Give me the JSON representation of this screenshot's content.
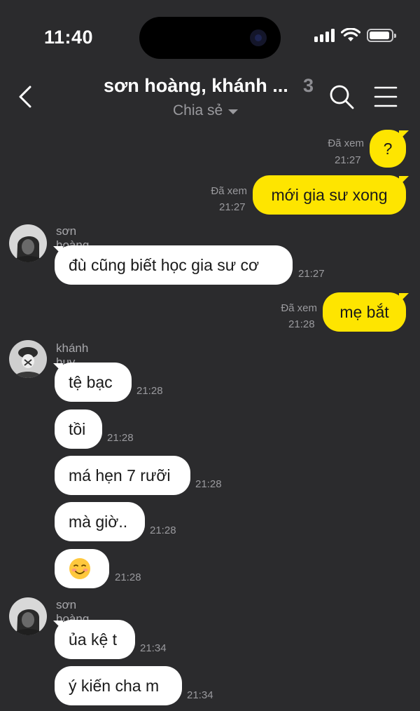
{
  "status_bar": {
    "time": "11:40"
  },
  "header": {
    "title": "sơn hoàng, khánh ...",
    "member_count": "3",
    "subtitle": "Chia sẻ"
  },
  "messages": [
    {
      "from": "me",
      "text": "?",
      "seen": "Đã xem",
      "time": "21:27"
    },
    {
      "from": "me",
      "text": "mới gia sư xong",
      "seen": "Đã xem",
      "time": "21:27"
    },
    {
      "from": "them",
      "sender": "sơn hoàng",
      "text": "đù cũng biết học gia sư cơ",
      "time": "21:27"
    },
    {
      "from": "me",
      "text": "mẹ bắt",
      "seen": "Đã xem",
      "time": "21:28"
    },
    {
      "from": "them",
      "sender": "khánh huy",
      "text": "tệ bạc",
      "time": "21:28"
    },
    {
      "from": "them",
      "text": "tồi",
      "time": "21:28"
    },
    {
      "from": "them",
      "text": "má hẹn 7 rưỡi",
      "time": "21:28"
    },
    {
      "from": "them",
      "text": "mà giờ..",
      "time": "21:28"
    },
    {
      "from": "them",
      "text": "☺️",
      "time": "21:28"
    },
    {
      "from": "them",
      "sender": "sơn hoàng",
      "text": "ủa kệ t",
      "time": "21:34"
    },
    {
      "from": "them",
      "text": "ý kiến cha m",
      "time": "21:34"
    }
  ],
  "colors": {
    "background": "#2b2b2d",
    "my_bubble": "#fee500",
    "their_bubble": "#ffffff",
    "meta_text": "#9a9a9e"
  }
}
